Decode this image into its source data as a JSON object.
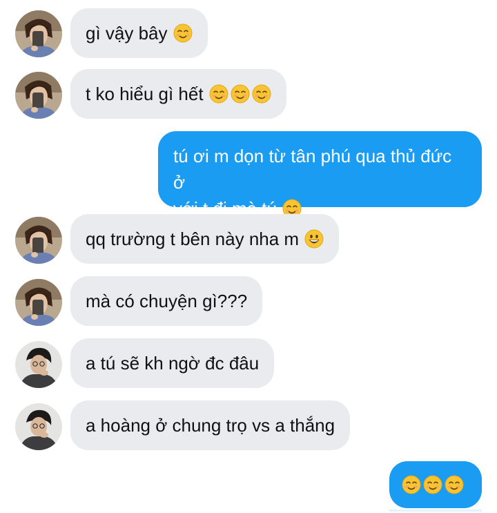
{
  "conversation": {
    "messages": [
      {
        "sender": "friend",
        "text": "gì vậy bây",
        "emoji": [
          "smiling-face-icon"
        ]
      },
      {
        "sender": "friend",
        "text": "t ko hiểu gì hết",
        "emoji": [
          "smiling-face-icon",
          "smiling-face-icon",
          "smiling-face-icon"
        ]
      },
      {
        "sender": "me",
        "text_line1": "tú ơi m dọn từ tân phú qua thủ đức ở",
        "text_line2": "với t đi mà tú",
        "emoji": [
          "smiling-face-icon"
        ]
      },
      {
        "sender": "friend",
        "text": "qq trường t bên này nha m",
        "emoji": [
          "grinning-face-icon"
        ]
      },
      {
        "sender": "friend",
        "text": "mà có chuyện gì???"
      },
      {
        "sender": "other-friend",
        "text": "a tú sẽ kh ngờ đc đâu"
      },
      {
        "sender": "other-friend",
        "text": "a hoàng ở chung trọ vs a thắng"
      },
      {
        "sender": "me",
        "emoji": [
          "smiling-face-icon",
          "smiling-face-icon",
          "smiling-face-icon"
        ]
      }
    ]
  },
  "colors": {
    "incoming_bubble": "#e9ebee",
    "outgoing_bubble": "#1a9cf2",
    "emoji_face": "#f7c531"
  }
}
